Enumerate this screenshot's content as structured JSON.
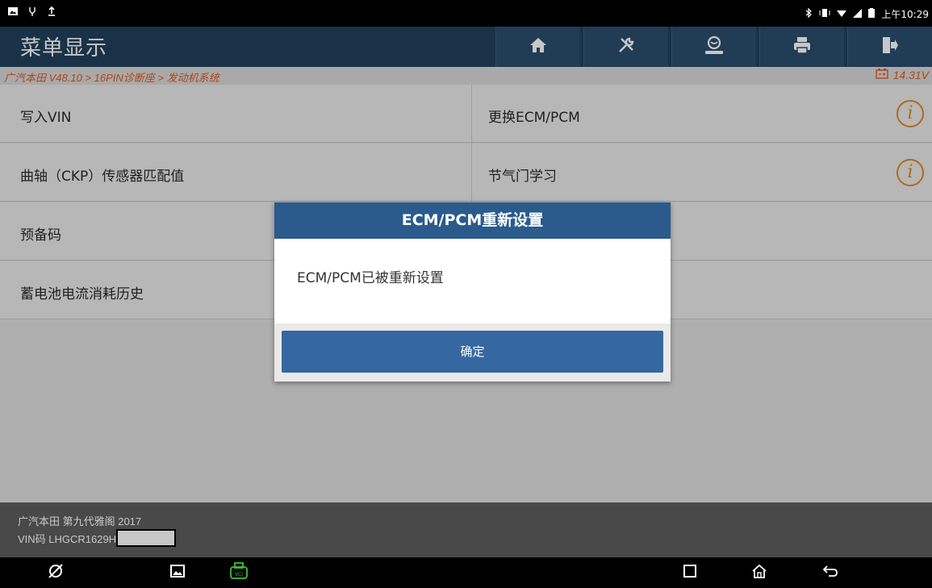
{
  "status_bar": {
    "time": "上午10:29"
  },
  "header": {
    "title": "菜单显示",
    "toolbar": [
      "home-icon",
      "tools-icon",
      "user-icon",
      "print-icon",
      "exit-icon"
    ]
  },
  "breadcrumb": {
    "path": "广汽本田 V48.10 > 16PIN诊断座 > 发动机系统",
    "voltage": "14.31V"
  },
  "menu": {
    "items": [
      {
        "label": "写入VIN"
      },
      {
        "label": "更换ECM/PCM",
        "info": true
      },
      {
        "label": "曲轴（CKP）传感器匹配值"
      },
      {
        "label": "节气门学习",
        "info": true
      },
      {
        "label": "预备码"
      },
      {
        "label": "蓄电池电流消耗历史"
      }
    ]
  },
  "footer": {
    "vehicle": "广汽本田 第九代雅阁 2017",
    "vin_prefix": "VIN码 LHGCR1629H"
  },
  "dialog": {
    "title": "ECM/PCM重新设置",
    "message": "ECM/PCM已被重新设置",
    "ok_label": "确定"
  },
  "colors": {
    "header": "#20415c",
    "accent_orange": "#e05a1f",
    "dialog_title": "#2a5b8c",
    "ok_button": "#3568a0"
  }
}
